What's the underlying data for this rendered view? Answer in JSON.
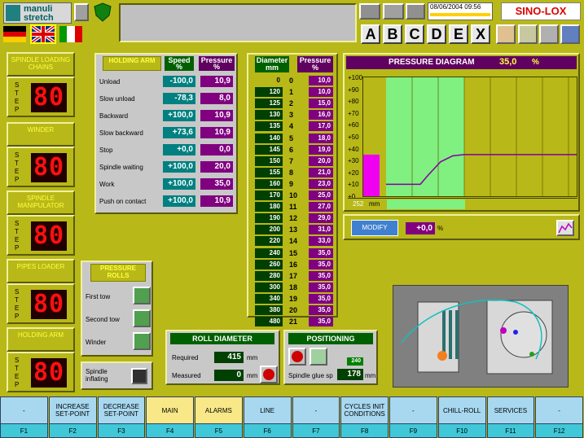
{
  "header": {
    "brand_line1": "manuli",
    "brand_line2": "stretch",
    "datetime": "08/06/2004  09:56",
    "letter_buttons": [
      "A",
      "B",
      "C",
      "D",
      "E",
      "X"
    ],
    "logo_text": "SINO-LOX"
  },
  "left_column": {
    "step_word": [
      "S",
      "T",
      "E",
      "P"
    ],
    "seg_value": "80",
    "panels": [
      {
        "title": "SPINDLE LOADING CHAINS"
      },
      {
        "title": "WINDER"
      },
      {
        "title": "SPINDLE MANIPULATOR"
      },
      {
        "title": "PIPES LOADER"
      },
      {
        "title": "HOLDING ARM"
      }
    ]
  },
  "holding_arm": {
    "title": "HOLDING ARM",
    "speed_header": "Speed",
    "pressure_header": "Pressure",
    "unit": "%",
    "rows": [
      {
        "label": "Unload",
        "speed": "-100,0",
        "pressure": "10,9"
      },
      {
        "label": "Slow unload",
        "speed": "-78,3",
        "pressure": "8,0"
      },
      {
        "label": "Backward",
        "speed": "+100,0",
        "pressure": "10,9"
      },
      {
        "label": "Slow backward",
        "speed": "+73,6",
        "pressure": "10,9"
      },
      {
        "label": "Stop",
        "speed": "+0,0",
        "pressure": "0,0"
      },
      {
        "label": "Spindle waiting",
        "speed": "+100,0",
        "pressure": "20,0"
      },
      {
        "label": "Work",
        "speed": "+100,0",
        "pressure": "35,0"
      },
      {
        "label": "Push on contact",
        "speed": "+100,0",
        "pressure": "10,9"
      }
    ]
  },
  "diameter_table": {
    "diameter_header": "Diameter",
    "diameter_unit": "mm",
    "pressure_header": "Pressure",
    "pressure_unit": "%",
    "rows": [
      {
        "d": "0",
        "i": "0",
        "p": "10,0"
      },
      {
        "d": "120",
        "i": "1",
        "p": "10,0"
      },
      {
        "d": "125",
        "i": "2",
        "p": "15,0"
      },
      {
        "d": "130",
        "i": "3",
        "p": "16,0"
      },
      {
        "d": "135",
        "i": "4",
        "p": "17,0"
      },
      {
        "d": "140",
        "i": "5",
        "p": "18,0"
      },
      {
        "d": "145",
        "i": "6",
        "p": "19,0"
      },
      {
        "d": "150",
        "i": "7",
        "p": "20,0"
      },
      {
        "d": "155",
        "i": "8",
        "p": "21,0"
      },
      {
        "d": "160",
        "i": "9",
        "p": "23,0"
      },
      {
        "d": "170",
        "i": "10",
        "p": "25,0"
      },
      {
        "d": "180",
        "i": "11",
        "p": "27,0"
      },
      {
        "d": "190",
        "i": "12",
        "p": "29,0"
      },
      {
        "d": "200",
        "i": "13",
        "p": "31,0"
      },
      {
        "d": "220",
        "i": "14",
        "p": "33,0"
      },
      {
        "d": "240",
        "i": "15",
        "p": "35,0"
      },
      {
        "d": "260",
        "i": "16",
        "p": "35,0"
      },
      {
        "d": "280",
        "i": "17",
        "p": "35,0"
      },
      {
        "d": "300",
        "i": "18",
        "p": "35,0"
      },
      {
        "d": "340",
        "i": "19",
        "p": "35,0"
      },
      {
        "d": "380",
        "i": "20",
        "p": "35,0"
      },
      {
        "d": "480",
        "i": "21",
        "p": "35,0"
      }
    ]
  },
  "pressure_diagram": {
    "title": "PRESSURE DIAGRAM",
    "value": "35,0",
    "unit": "%",
    "y_ticks": [
      "+100",
      "+90",
      "+80",
      "+70",
      "+60",
      "+50",
      "+40",
      "+30",
      "+20",
      "+10",
      "+0"
    ],
    "diameter_readout": "252",
    "diameter_unit": "mm",
    "modify_label": "MODIFY",
    "modify_value": "+0,0",
    "modify_unit": "%"
  },
  "pressure_rolls": {
    "title": "PRESSURE ROLLS",
    "items": [
      "First tow",
      "Second tow",
      "Winder"
    ],
    "inflating_label": "Spindle inflating"
  },
  "roll_diameter": {
    "title": "ROLL DIAMETER",
    "required_label": "Required",
    "required_value": "415",
    "measured_label": "Measured",
    "measured_value": "0",
    "unit": "mm"
  },
  "positioning": {
    "title": "POSITIONING",
    "small_value": "240",
    "glue_label": "Spindle glue sp",
    "glue_value": "178",
    "unit": "mm"
  },
  "function_keys": [
    {
      "label": "-",
      "key": "F1",
      "color": "#a8d8f0"
    },
    {
      "label": "INCREASE SET-POINT",
      "key": "F2",
      "color": "#a8d8f0"
    },
    {
      "label": "DECREASE SET-POINT",
      "key": "F3",
      "color": "#a8d8f0"
    },
    {
      "label": "MAIN",
      "key": "F4",
      "color": "#f8e888"
    },
    {
      "label": "ALARMS",
      "key": "F5",
      "color": "#f8e888"
    },
    {
      "label": "LINE",
      "key": "F6",
      "color": "#a8d8f0"
    },
    {
      "label": "-",
      "key": "F7",
      "color": "#a8d8f0"
    },
    {
      "label": "CYCLES INIT CONDITIONS",
      "key": "F8",
      "color": "#a8d8f0"
    },
    {
      "label": "-",
      "key": "F9",
      "color": "#a8d8f0"
    },
    {
      "label": "CHILL-ROLL",
      "key": "F10",
      "color": "#a8d8f0"
    },
    {
      "label": "SERVICES",
      "key": "F11",
      "color": "#a8d8f0"
    },
    {
      "label": "-",
      "key": "F12",
      "color": "#a8d8f0"
    }
  ]
}
